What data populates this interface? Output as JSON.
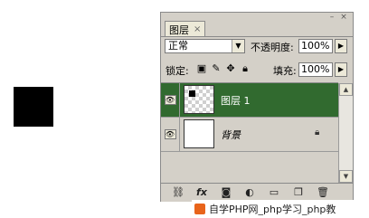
{
  "panel": {
    "tab_title": "图层",
    "tab_close": "×",
    "minimize_glyph": "–",
    "close_glyph": "×",
    "blend_mode": "正常",
    "opacity_label": "不透明度:",
    "opacity_value": "100%",
    "lock_label": "锁定:",
    "fill_label": "填充:",
    "fill_value": "100%"
  },
  "layers": [
    {
      "name": "图层 1",
      "selected": true,
      "visible": true
    },
    {
      "name": "背景",
      "selected": false,
      "visible": true,
      "locked": true
    }
  ],
  "bottom_icons": [
    "link-icon",
    "fx-icon",
    "mask-icon",
    "adjustment-icon",
    "folder-icon",
    "new-layer-icon",
    "trash-icon"
  ],
  "fx_label": "fx",
  "watermark": {
    "text": "自学PHP网_php学习_php教"
  },
  "colors": {
    "selected_row": "#316a2f",
    "panel_bg": "#d4d0c8"
  }
}
